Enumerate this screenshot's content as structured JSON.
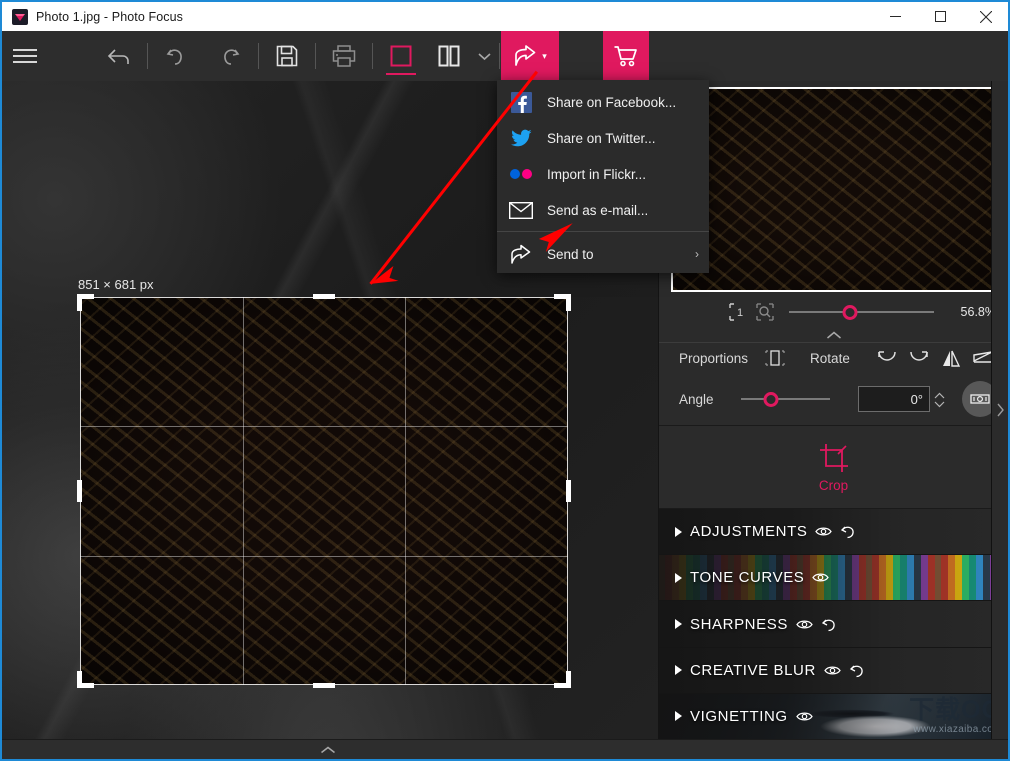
{
  "window": {
    "title": "Photo 1.jpg - Photo Focus",
    "app_icon": "app-logo-icon",
    "minimize": "—",
    "maximize": "□",
    "close": "✕"
  },
  "toolbar": {
    "menu_label": "hamburger-menu",
    "back_label": "back",
    "undo_label": "undo",
    "redo_label": "redo",
    "save_label": "save",
    "print_label": "print",
    "single_view_label": "single-view",
    "split_view_label": "split-view",
    "view_more_label": "⌄",
    "share_label": "share",
    "share_caret": "▾",
    "cart_label": "cart"
  },
  "share_menu": {
    "items": [
      {
        "label": "Share on Facebook...",
        "icon": "facebook-icon",
        "submenu": ""
      },
      {
        "label": "Share on Twitter...",
        "icon": "twitter-icon",
        "submenu": ""
      },
      {
        "label": "Import in Flickr...",
        "icon": "flickr-icon",
        "submenu": ""
      },
      {
        "label": "Send as e-mail...",
        "icon": "envelope-icon",
        "submenu": ""
      },
      {
        "label": "Send to",
        "icon": "share-icon",
        "submenu": "›"
      }
    ]
  },
  "canvas": {
    "dimensions_label": "851 × 681 px",
    "image_alt": "venetian-mask-photo"
  },
  "panel": {
    "zoom": {
      "fit_icon": "fit-to-screen-icon",
      "magnifier_icon": "magnifier-icon",
      "value": "56.8%",
      "slider_percent": 42
    },
    "collapse_icon": "⌃",
    "proportions": {
      "label": "Proportions",
      "proportions_icon": "proportions-icon",
      "rotate_label": "Rotate",
      "rotate_left_icon": "rotate-left-icon",
      "rotate_right_icon": "rotate-right-icon",
      "flip_horizontal_icon": "flip-horizontal-icon",
      "flip_vertical_icon": "flip-vertical-icon"
    },
    "angle": {
      "label": "Angle",
      "value": "0°",
      "slider_percent": 34,
      "level_icon": "level-tool-icon",
      "spinner_up": "⌃",
      "spinner_down": "⌄"
    },
    "crop": {
      "label": "Crop",
      "icon": "crop-icon",
      "accent": "#e0195f"
    },
    "sections": [
      {
        "label": "ADJUSTMENTS",
        "eye_icon": "eye-icon",
        "reset_icon": "reset-icon",
        "has_reset": true,
        "thumb": "gears-thumb"
      },
      {
        "label": "TONE CURVES",
        "eye_icon": "eye-icon",
        "reset_icon": "",
        "has_reset": false,
        "thumb": "pencils-thumb"
      },
      {
        "label": "SHARPNESS",
        "eye_icon": "eye-icon",
        "reset_icon": "reset-icon",
        "has_reset": true,
        "thumb": "tiger-eye-thumb"
      },
      {
        "label": "CREATIVE BLUR",
        "eye_icon": "eye-icon",
        "reset_icon": "reset-icon",
        "has_reset": true,
        "thumb": "city-blur-thumb"
      },
      {
        "label": "VIGNETTING",
        "eye_icon": "eye-icon",
        "reset_icon": "",
        "has_reset": false,
        "thumb": "suit-thumb"
      }
    ],
    "expand_flap_icon": "›"
  },
  "watermark": {
    "brand": "下载OO",
    "url": "www.xiazaiba.com"
  },
  "bottom_bar": {
    "chevron": "⌃"
  },
  "colors": {
    "accent_pink": "#e0195f",
    "window_border": "#1e8ad6",
    "panel_bg": "#2b2b2b",
    "toolbar_bg": "#2d2d2d"
  }
}
